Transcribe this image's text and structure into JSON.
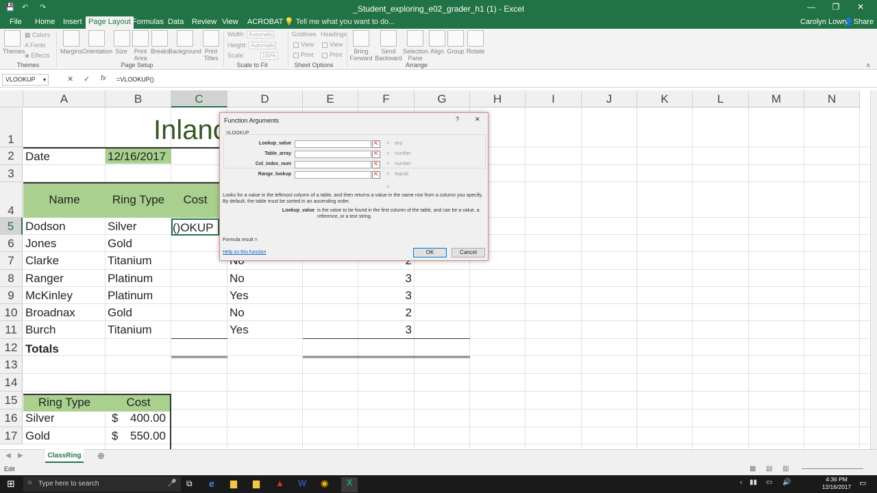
{
  "window": {
    "title": "_Student_exploring_e02_grader_h1 (1) - Excel",
    "user": "Carolyn Lowry",
    "share_label": "Share"
  },
  "ribbon": {
    "tabs": [
      "File",
      "Home",
      "Insert",
      "Page Layout",
      "Formulas",
      "Data",
      "Review",
      "View",
      "ACROBAT"
    ],
    "active_tab": "Page Layout",
    "tell_me": "Tell me what you want to do...",
    "themes": {
      "big": "Themes",
      "colors": "Colors",
      "fonts": "Fonts",
      "effects": "Effects",
      "group": "Themes"
    },
    "page_setup": {
      "margins": "Margins",
      "orientation": "Orientation",
      "size": "Size",
      "print_area": "Print Area",
      "breaks": "Breaks",
      "background": "Background",
      "print_titles": "Print Titles",
      "group": "Page Setup"
    },
    "scale_to_fit": {
      "width_label": "Width:",
      "width_value": "Automatic",
      "height_label": "Height:",
      "height_value": "Automatic",
      "scale_label": "Scale:",
      "scale_value": "100%",
      "group": "Scale to Fit"
    },
    "sheet_options": {
      "gridlines": "Gridlines",
      "headings": "Headings",
      "view": "View",
      "print": "Print",
      "group": "Sheet Options"
    },
    "arrange": {
      "bring_forward": "Bring Forward",
      "send_backward": "Send Backward",
      "selection_pane": "Selection Pane",
      "align": "Align",
      "group_btn": "Group",
      "rotate": "Rotate",
      "group": "Arrange"
    }
  },
  "formula_bar": {
    "name_box": "VLOOKUP",
    "formula": "=VLOOKUP()"
  },
  "grid": {
    "columns": [
      "A",
      "B",
      "C",
      "D",
      "E",
      "F",
      "G",
      "H",
      "I",
      "J",
      "K",
      "L",
      "M",
      "N"
    ],
    "rows": [
      "1",
      "2",
      "3",
      "4",
      "5",
      "6",
      "7",
      "8",
      "9",
      "10",
      "11",
      "12",
      "13",
      "14",
      "15",
      "16",
      "17"
    ],
    "title_fragment": "Inlanc",
    "date_label": "Date",
    "date_value": "12/16/2017",
    "header": {
      "name": "Name",
      "ring_type": "Ring Type",
      "cost": "Cost"
    },
    "active_cell_text": "OKUP()",
    "records": [
      {
        "name": "Dodson",
        "ring": "Silver",
        "d": "",
        "f": ""
      },
      {
        "name": "Jones",
        "ring": "Gold",
        "d": "",
        "f": ""
      },
      {
        "name": "Clarke",
        "ring": "Titanium",
        "d": "No",
        "f": "2"
      },
      {
        "name": "Ranger",
        "ring": "Platinum",
        "d": "No",
        "f": "3"
      },
      {
        "name": "McKinley",
        "ring": "Platinum",
        "d": "Yes",
        "f": "3"
      },
      {
        "name": "Broadnax",
        "ring": "Gold",
        "d": "No",
        "f": "2"
      },
      {
        "name": "Burch",
        "ring": "Titanium",
        "d": "Yes",
        "f": "3"
      }
    ],
    "totals_label": "Totals",
    "lookup_header": {
      "ring_type": "Ring Type",
      "cost": "Cost"
    },
    "lookup_rows": [
      {
        "ring": "Silver",
        "currency": "$",
        "amount": "400.00"
      },
      {
        "ring": "Gold",
        "currency": "$",
        "amount": "550.00"
      }
    ]
  },
  "dialog": {
    "title": "Function Arguments",
    "help_glyph": "?",
    "close_glyph": "✕",
    "function_name": "VLOOKUP",
    "args": [
      {
        "label": "Lookup_value",
        "result": "any"
      },
      {
        "label": "Table_array",
        "result": "number"
      },
      {
        "label": "Col_index_num",
        "result": "number"
      },
      {
        "label": "Range_lookup",
        "result": "logical"
      }
    ],
    "eq_sign": "=",
    "description": "Looks for a value in the leftmost column of a table, and then returns a value in the same row from a column you specify. By default, the table must be sorted in an ascending order.",
    "arg_help_name": "Lookup_value",
    "arg_help_text": "is the value to be found in the first column of the table, and can be a value, a reference, or a text string.",
    "formula_result": "Formula result =",
    "help_link": "Help on this function",
    "ok": "OK",
    "cancel": "Cancel"
  },
  "sheet_tab": "ClassRing",
  "status": "Edit",
  "taskbar": {
    "search_placeholder": "Type here to search",
    "time": "4:36 PM",
    "date": "12/16/2017"
  }
}
